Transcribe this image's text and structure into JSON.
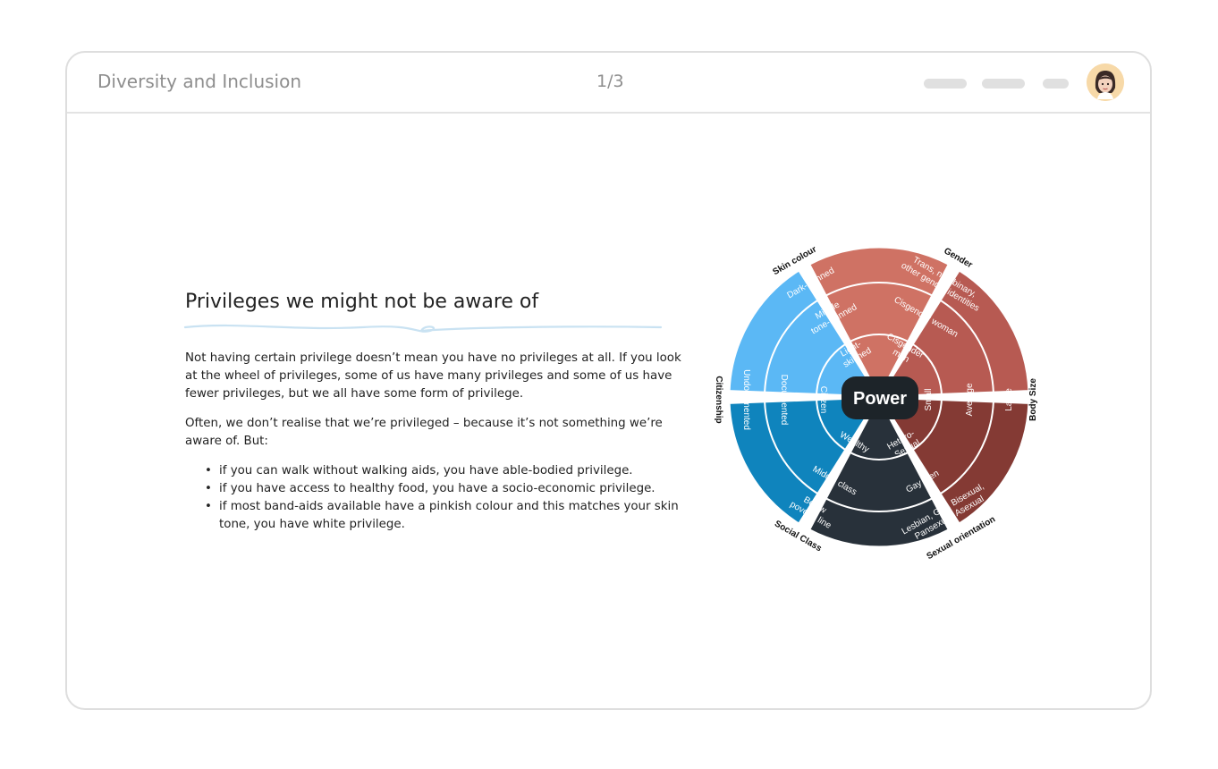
{
  "header": {
    "app_title": "Diversity and Inclusion",
    "pager": "1/3",
    "avatar_icon": "woman-avatar-icon"
  },
  "content": {
    "heading": "Privileges we might not be aware of",
    "paragraph1": "Not having certain privilege doesn’t mean you have no privileges at all. If you look at the wheel of privileges, some of us have many privileges and some of us have fewer privileges, but we all have some form of privilege.",
    "paragraph2": "Often, we don’t realise that we’re privileged – because it’s not something we’re aware of. But:",
    "bullets": [
      "if you can walk without walking aids, you have able-bodied privilege.",
      "if you have access to healthy food, you have a socio-economic privilege.",
      "if most band-aids available have a pinkish colour and this matches your skin tone, you have white privilege."
    ]
  },
  "wheel": {
    "center": "Power",
    "categories": {
      "skin_colour": "Skin colour",
      "gender": "Gender",
      "body_size": "Body Size",
      "sexual_orientation": "Sexual orientation",
      "social_class": "Social Class",
      "citizenship": "Citizenship"
    },
    "labels": {
      "light_skinned_1": "Light-",
      "light_skinned_2": "skinned",
      "middle_tone_1": "Middle",
      "middle_tone_2": "tone-skinned",
      "dark_skinned": "Dark-skinned",
      "cis_man_1": "Cisgender",
      "cis_man_2": "man",
      "cis_woman": "Cisgender woman",
      "trans_1": "Trans, non-binary,",
      "trans_2": "other gender identities",
      "small": "Small",
      "average": "Average",
      "large": "Large",
      "hetero_1": "Hetero-",
      "hetero_2": "Sexual",
      "gay_men": "Gay men",
      "lgb_1": "Lesbian, Gay, Bisexual,",
      "lgb_2": "Pansexual, Asexual",
      "wealthy": "Wealthy",
      "middle_class": "Middle class",
      "below_1": "Below",
      "below_2": "poverty line",
      "citizen": "Citizen",
      "documented": "Documented",
      "undocumented": "Undocumented"
    },
    "colors": {
      "skin": "#5bb8f5",
      "gender": "#cf7264",
      "body": "#b75a52",
      "orientation": "#843a34",
      "class": "#28313a",
      "citizenship": "#0f84bd",
      "center": "#1d2429"
    }
  }
}
